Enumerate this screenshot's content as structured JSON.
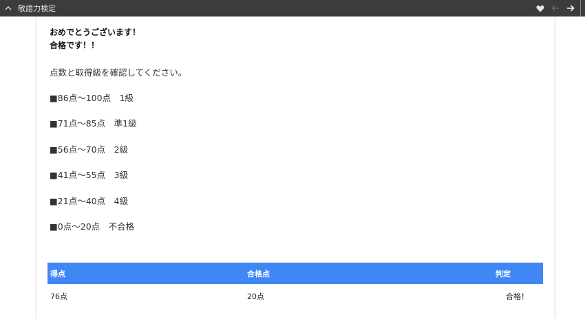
{
  "topbar": {
    "title": "敬語力検定"
  },
  "message": {
    "line1": "おめでとうございます！",
    "line2": "合格です！！"
  },
  "instruction": "点数と取得級を確認してください。",
  "grades": [
    "■86点〜100点　1級",
    "■71点〜85点　準1級",
    "■56点〜70点　2級",
    "■41点〜55点　3級",
    "■21点〜40点　4級",
    "■0点〜20点　不合格"
  ],
  "table": {
    "headers": [
      "得点",
      "合格点",
      "判定"
    ],
    "row": [
      "76点",
      "20点",
      "合格！"
    ]
  },
  "colors": {
    "topbar": "#3c3c3c",
    "table_header": "#3f87f5"
  }
}
